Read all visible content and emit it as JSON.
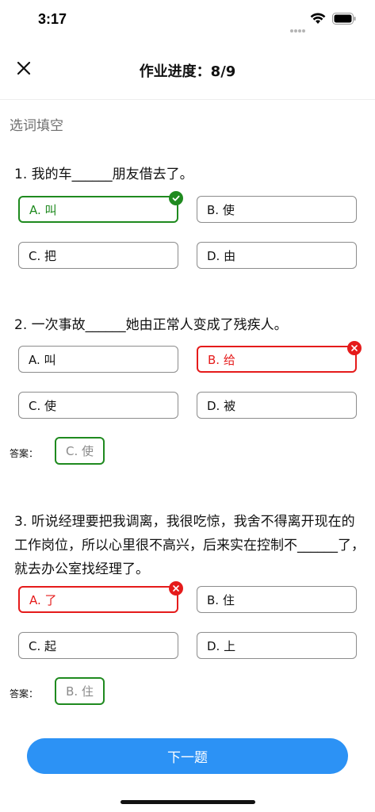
{
  "status": {
    "time": "3:17"
  },
  "header": {
    "title": "作业进度：8/9"
  },
  "section": {
    "title": "选词填空"
  },
  "questions": [
    {
      "text": "1. 我的车______朋友借去了。",
      "options": [
        "A. 叫",
        "B. 使",
        "C. 把",
        "D. 由"
      ]
    },
    {
      "text": "2. 一次事故______她由正常人变成了残疾人。",
      "options": [
        "A. 叫",
        "B. 给",
        "C. 使",
        "D. 被"
      ],
      "answer_label": "答案：",
      "answer": "C. 使"
    },
    {
      "text": "3. 听说经理要把我调离，我很吃惊，我舍不得离开现在的工作岗位，所以心里很不高兴，后来实在控制不______了，就去办公室找经理了。",
      "options": [
        "A. 了",
        "B. 住",
        "C. 起",
        "D. 上"
      ],
      "answer_label": "答案：",
      "answer": "B. 住"
    }
  ],
  "footer": {
    "next_label": "下一题"
  },
  "colors": {
    "correct": "#1f8a1f",
    "wrong": "#e51b1b",
    "primary": "#2c92f5"
  }
}
